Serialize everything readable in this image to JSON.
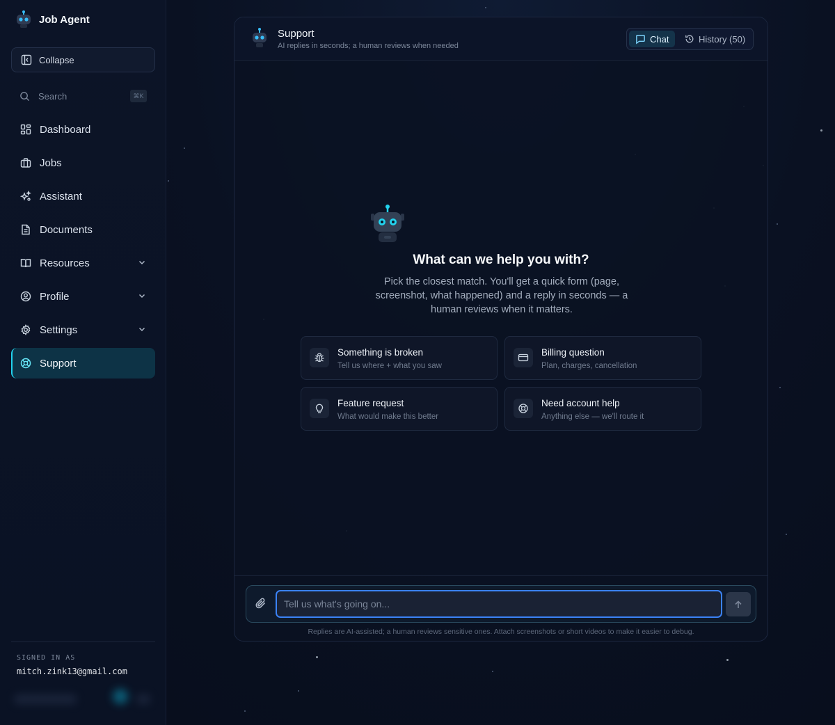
{
  "app": {
    "name": "Job Agent"
  },
  "sidebar": {
    "collapse_label": "Collapse",
    "search_label": "Search",
    "search_shortcut": "⌘K",
    "items": [
      {
        "label": "Dashboard",
        "icon": "dashboard-icon"
      },
      {
        "label": "Jobs",
        "icon": "briefcase-icon"
      },
      {
        "label": "Assistant",
        "icon": "sparkles-icon"
      },
      {
        "label": "Documents",
        "icon": "document-icon"
      },
      {
        "label": "Resources",
        "icon": "book-icon",
        "expandable": true
      },
      {
        "label": "Profile",
        "icon": "user-circle-icon",
        "expandable": true
      },
      {
        "label": "Settings",
        "icon": "gear-icon",
        "expandable": true
      },
      {
        "label": "Support",
        "icon": "lifebuoy-icon",
        "active": true
      }
    ],
    "signed_in_label": "SIGNED IN AS",
    "signed_in_email": "mitch.zink13@gmail.com"
  },
  "header": {
    "title": "Support",
    "subtitle": "AI replies in seconds; a human reviews when needed",
    "tabs": [
      {
        "label": "Chat",
        "active": true
      },
      {
        "label": "History (50)",
        "active": false
      }
    ]
  },
  "hero": {
    "title": "What can we help you with?",
    "subtitle": "Pick the closest match. You'll get a quick form (page, screenshot, what happened) and a reply in seconds — a human reviews when it matters."
  },
  "cards": [
    {
      "title": "Something is broken",
      "subtitle": "Tell us where + what you saw",
      "icon": "bug-icon"
    },
    {
      "title": "Billing question",
      "subtitle": "Plan, charges, cancellation",
      "icon": "credit-card-icon"
    },
    {
      "title": "Feature request",
      "subtitle": "What would make this better",
      "icon": "lightbulb-icon"
    },
    {
      "title": "Need account help",
      "subtitle": "Anything else — we'll route it",
      "icon": "lifebuoy-icon"
    }
  ],
  "composer": {
    "placeholder": "Tell us what's going on...",
    "note": "Replies are AI-assisted; a human reviews sensitive ones. Attach screenshots or short videos to make it easier to debug."
  },
  "colors": {
    "accent": "#22d3ee",
    "focus": "#3b82f6",
    "background": "#0a1122"
  }
}
